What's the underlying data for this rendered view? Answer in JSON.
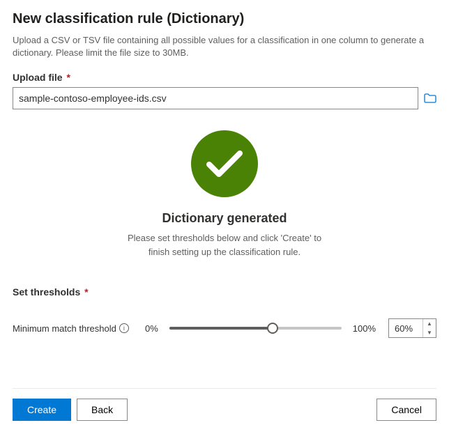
{
  "header": {
    "title": "New classification rule (Dictionary)",
    "description": "Upload a CSV or TSV file containing all possible values for a classification in one column to generate a dictionary. Please limit the file size to 30MB."
  },
  "upload": {
    "label": "Upload file",
    "required_marker": "*",
    "value": "sample-contoso-employee-ids.csv"
  },
  "success": {
    "title": "Dictionary generated",
    "subtitle": "Please set thresholds below and click 'Create' to finish setting up the classification rule."
  },
  "thresholds": {
    "section_title": "Set thresholds",
    "required_marker": "*",
    "slider_label": "Minimum match threshold",
    "min_label": "0%",
    "max_label": "100%",
    "value": "60%",
    "value_pct": 60
  },
  "footer": {
    "create": "Create",
    "back": "Back",
    "cancel": "Cancel"
  }
}
